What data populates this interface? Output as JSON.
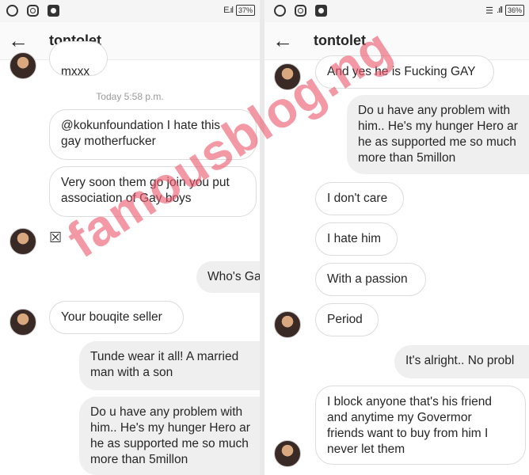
{
  "left_panel": {
    "status_bar": {
      "signal": "E.ıl",
      "battery": "37%"
    },
    "header": {
      "title": "tontolet"
    },
    "timestamp": "Today 5:58 p.m.",
    "messages": {
      "m0": "mxxx",
      "m1_mention": "@kokunfoundation",
      "m1_rest": " I hate this",
      "m1_line2": "gay motherfucker",
      "m2_line1": "Very soon them go join you put",
      "m2_line2": "association of Gay boys",
      "m3": "☒",
      "m4": "Who's Ga",
      "m5": "Your bouqite seller",
      "m6_line1": "Tunde wear it all!  A married",
      "m6_line2": "man with a son",
      "m7_line1": "Do u have any problem with",
      "m7_line2": "him.. He's my hunger Hero ar",
      "m7_line3": "he as supported me so much",
      "m7_line4": "more than 5millon"
    }
  },
  "right_panel": {
    "status_bar": {
      "signal": ".ıll",
      "battery": "36%"
    },
    "header": {
      "title": "tontolet"
    },
    "messages": {
      "m1": "And yes he is Fucking GAY",
      "m2_line1": "Do u have any problem with",
      "m2_line2": "him.. He's my hunger Hero ar",
      "m2_line3": "he as supported me so much",
      "m2_line4": "more than 5millon",
      "m3": "I don't care",
      "m4": "I hate him",
      "m5": "With a passion",
      "m6": "Period",
      "m7": "It's alright.. No probl",
      "m8_line1": "I block anyone that's his friend",
      "m8_line2": "and anytime my Govermor",
      "m8_line3": "friends want to buy from him I",
      "m8_line4": "never let them"
    }
  },
  "watermark": "famousblog.ng"
}
